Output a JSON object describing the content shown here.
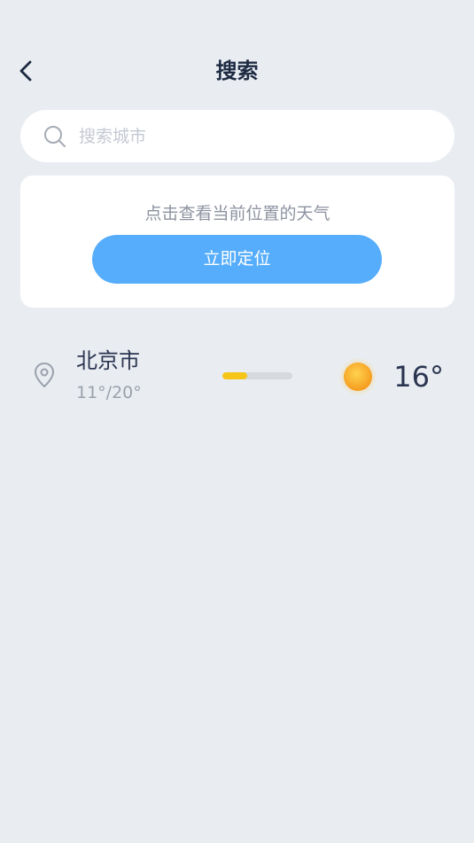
{
  "header": {
    "title": "搜索",
    "back_icon": "chevron-left-icon"
  },
  "search": {
    "placeholder": "搜索城市",
    "value": "",
    "icon": "search-icon"
  },
  "locate": {
    "hint": "点击查看当前位置的天气",
    "button_label": "立即定位",
    "button_color": "#56adfb"
  },
  "cities": [
    {
      "name": "北京市",
      "range": "11°/20°",
      "range_fill_fraction": 0.36,
      "range_fill_color": "#f5c518",
      "weather_icon": "sun-icon",
      "current_temp": "16°",
      "location_icon": "map-pin-icon"
    }
  ],
  "colors": {
    "background": "#e9edf2",
    "card": "#ffffff",
    "accent": "#56adfb"
  }
}
